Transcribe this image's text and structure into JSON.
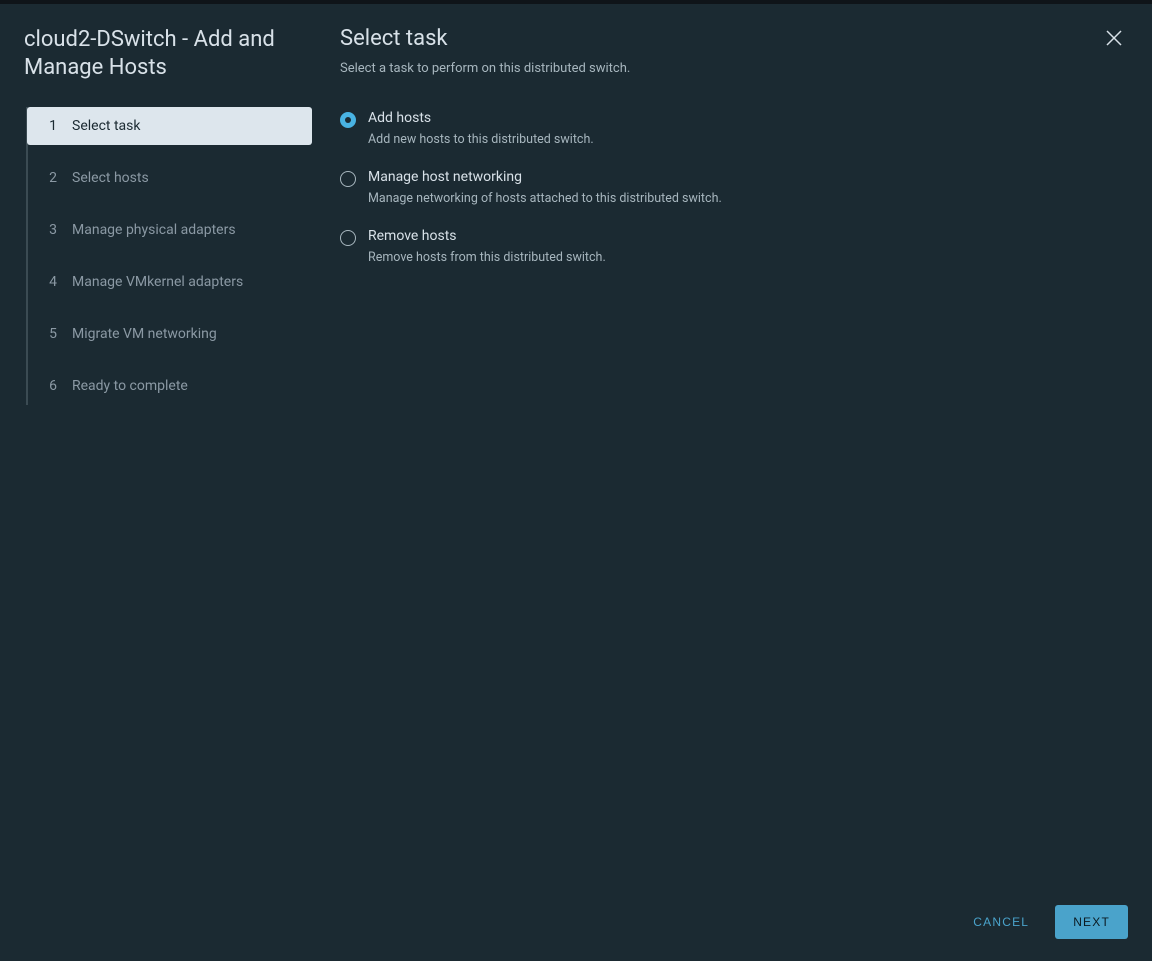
{
  "wizard": {
    "title": "cloud2-DSwitch - Add and Manage Hosts",
    "steps": [
      {
        "num": "1",
        "label": "Select task",
        "active": true
      },
      {
        "num": "2",
        "label": "Select hosts",
        "active": false
      },
      {
        "num": "3",
        "label": "Manage physical adapters",
        "active": false
      },
      {
        "num": "4",
        "label": "Manage VMkernel adapters",
        "active": false
      },
      {
        "num": "5",
        "label": "Migrate VM networking",
        "active": false
      },
      {
        "num": "6",
        "label": "Ready to complete",
        "active": false
      }
    ]
  },
  "main": {
    "title": "Select task",
    "subtitle": "Select a task to perform on this distributed switch.",
    "options": [
      {
        "title": "Add hosts",
        "desc": "Add new hosts to this distributed switch.",
        "selected": true
      },
      {
        "title": "Manage host networking",
        "desc": "Manage networking of hosts attached to this distributed switch.",
        "selected": false
      },
      {
        "title": "Remove hosts",
        "desc": "Remove hosts from this distributed switch.",
        "selected": false
      }
    ]
  },
  "footer": {
    "cancel": "CANCEL",
    "next": "NEXT"
  }
}
